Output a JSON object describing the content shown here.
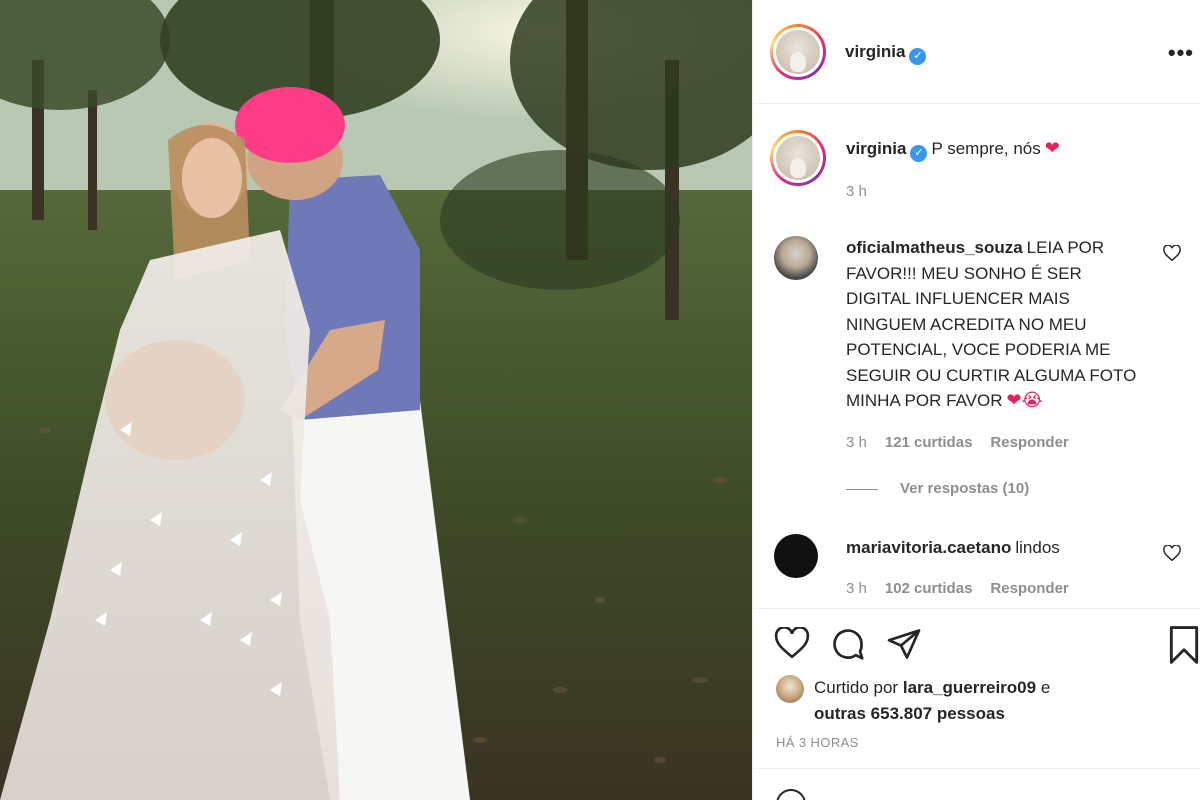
{
  "post": {
    "username": "virginia",
    "verified_icon": "verified-badge-icon",
    "more_icon": "more-options-icon"
  },
  "caption": {
    "username": "virginia",
    "text": "P sempre, nós",
    "emoji": "❤",
    "time": "3 h"
  },
  "comments": [
    {
      "username": "oficialmatheus_souza",
      "text": "LEIA POR FAVOR!!! MEU SONHO É SER DIGITAL INFLUENCER MAIS NINGUEM ACREDITA NO MEU POTENCIAL, VOCE PODERIA ME SEGUIR OU CURTIR ALGUMA FOTO MINHA POR FAVOR",
      "emoji": "❤😭",
      "time": "3 h",
      "likes": "121 curtidas",
      "reply": "Responder",
      "view_replies": "Ver respostas (10)"
    },
    {
      "username": "mariavitoria.caetano",
      "text": "lindos",
      "time": "3 h",
      "likes": "102 curtidas",
      "reply": "Responder"
    }
  ],
  "likes": {
    "prefix": "Curtido por",
    "user": "lara_guerreiro09",
    "conj": "e",
    "others": "outras 653.807 pessoas"
  },
  "timestamp": "HÁ 3 HORAS",
  "colors": {
    "verified": "#3897f0",
    "muted": "#8e8e8e",
    "text": "#262626",
    "heart": "#e0245e"
  }
}
